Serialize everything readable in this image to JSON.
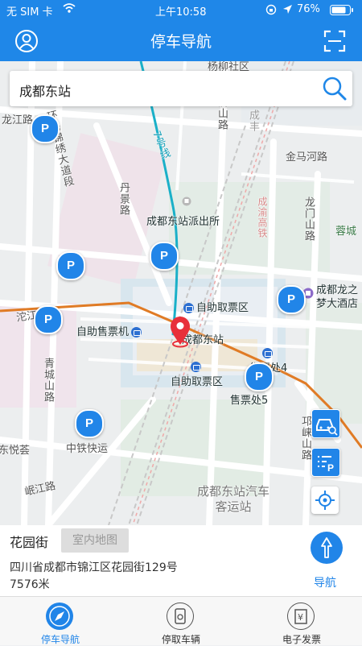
{
  "status_bar": {
    "carrier": "无 SIM 卡",
    "time": "上午10:58",
    "battery": "76%"
  },
  "header": {
    "title": "停车导航"
  },
  "search": {
    "value": "成都东站"
  },
  "map": {
    "labels": {
      "yangliu": "杨柳社区",
      "longjiang": "龙江路",
      "huanlu": "环路锦绣大道段",
      "line7": "7号线",
      "jiyuan": "济山路",
      "chengfeng": "成丰",
      "jinma": "金马河路",
      "danjing": "丹景路",
      "longmen": "龙门山路",
      "rongcheng": "蓉城",
      "police": "成都东站派出所",
      "chengyu": "成渝高铁",
      "hotel": "成都龙之梦大酒店",
      "tuojiang": "沱江",
      "ticket_pick1": "自助取票区",
      "ticket_machine": "自助售票机",
      "station": "成都东站",
      "ticket_office4": "售票处4",
      "ticket_pick2": "自助取票区",
      "ticket_office5": "售票处5",
      "qingcheng": "青城山路",
      "qionglai": "邛崃山路",
      "yuecai": "东悦荟",
      "zhongtie": "中铁快运",
      "minjiang": "岷江路",
      "bus_station": "成都东站汽车客运站"
    },
    "parking_badge": "P"
  },
  "info": {
    "name": "花园街",
    "indoor_btn": "室内地图",
    "address": "四川省成都市锦江区花园街129号",
    "distance": "7576米",
    "nav_label": "导航"
  },
  "tabs": [
    {
      "label": "停车导航",
      "active": true
    },
    {
      "label": "停取车辆",
      "active": false
    },
    {
      "label": "电子发票",
      "active": false
    }
  ],
  "colors": {
    "accent": "#1f87e8",
    "pin": "#e8303a",
    "metro": "#1ab0c8",
    "rail": "#e07b25"
  }
}
